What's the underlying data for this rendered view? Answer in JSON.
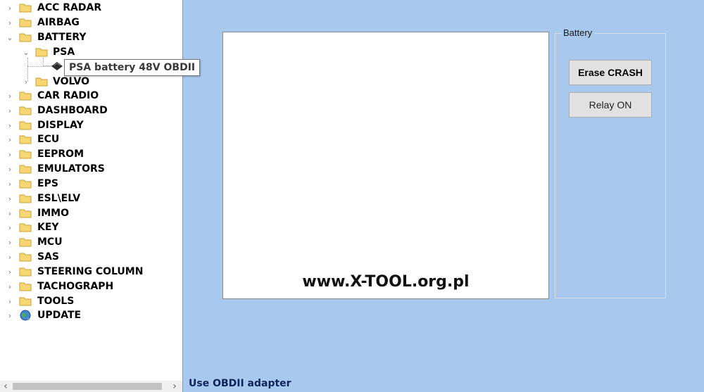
{
  "tree": {
    "items": [
      {
        "label": "ACC RADAR",
        "expander": "›",
        "icon": "folder-icon"
      },
      {
        "label": "AIRBAG",
        "expander": "›",
        "icon": "folder-icon"
      },
      {
        "label": "BATTERY",
        "expander": "⌄",
        "icon": "folder-icon"
      },
      {
        "label": "PSA",
        "expander": "⌄",
        "icon": "folder-icon"
      },
      {
        "label": "VOLVO",
        "expander": "›",
        "icon": "folder-icon"
      },
      {
        "label": "CAR RADIO",
        "expander": "›",
        "icon": "folder-icon"
      },
      {
        "label": "DASHBOARD",
        "expander": "›",
        "icon": "folder-icon"
      },
      {
        "label": "DISPLAY",
        "expander": "›",
        "icon": "folder-icon"
      },
      {
        "label": "ECU",
        "expander": "›",
        "icon": "folder-icon"
      },
      {
        "label": "EEPROM",
        "expander": "›",
        "icon": "folder-icon"
      },
      {
        "label": "EMULATORS",
        "expander": "›",
        "icon": "folder-icon"
      },
      {
        "label": "EPS",
        "expander": "›",
        "icon": "folder-icon"
      },
      {
        "label": "ESL\\ELV",
        "expander": "›",
        "icon": "folder-icon"
      },
      {
        "label": "IMMO",
        "expander": "›",
        "icon": "folder-icon"
      },
      {
        "label": "KEY",
        "expander": "›",
        "icon": "folder-icon"
      },
      {
        "label": "MCU",
        "expander": "›",
        "icon": "folder-icon"
      },
      {
        "label": "SAS",
        "expander": "›",
        "icon": "folder-icon"
      },
      {
        "label": "STEERING COLUMN",
        "expander": "›",
        "icon": "folder-icon"
      },
      {
        "label": "TACHOGRAPH",
        "expander": "›",
        "icon": "folder-icon"
      },
      {
        "label": "TOOLS",
        "expander": "›",
        "icon": "folder-icon"
      },
      {
        "label": "UPDATE",
        "expander": "›",
        "icon": "globe-icon"
      }
    ],
    "selected_item": {
      "icon": "chip-icon"
    },
    "tooltip": "PSA battery 48V OBDII",
    "scroll_left": "‹",
    "scroll_right": "›"
  },
  "output": {
    "watermark": "www.X-TOOL.org.pl"
  },
  "battery_group": {
    "title": "Battery",
    "erase_button": "Erase CRASH",
    "relay_button": "Relay ON"
  },
  "status": "Use OBDII adapter",
  "colors": {
    "background": "#a8c8ee",
    "folder_fill": "#f6d774",
    "folder_edge": "#c9a02e",
    "status_text": "#10245c"
  }
}
